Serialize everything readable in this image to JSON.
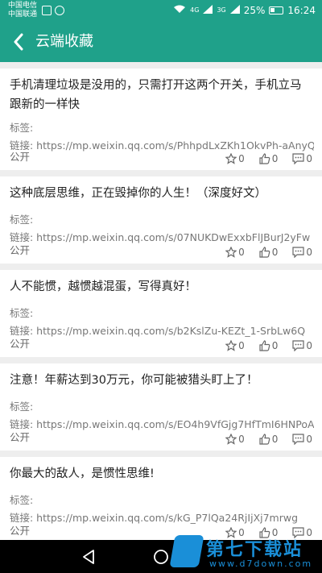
{
  "status_bar": {
    "carrier1": "中国电信",
    "carrier2": "中国联通",
    "network": "4G",
    "network_sub": "3G",
    "battery": "25%",
    "time": "16:24"
  },
  "app_bar": {
    "title": "云端收藏",
    "back_icon": "chevron-left-icon",
    "color": "#1fa18a"
  },
  "cards": [
    {
      "title": "手机清理垃圾是没用的，只需打开这两个开关，手机立马跟新的一样快",
      "tag": "标签:",
      "link": "链接: https://mp.weixin.qq.com/s/PhhpdLxZKh1OkvPh-aAnyQ",
      "public": "公开",
      "stars": "0",
      "likes": "0",
      "comments": "0"
    },
    {
      "title": "这种底层思维，正在毁掉你的人生！（深度好文）",
      "tag": "标签:",
      "link": "链接: https://mp.weixin.qq.com/s/07NUKDwExxbFlJBurJ2yFw",
      "public": "公开",
      "stars": "0",
      "likes": "0",
      "comments": "0"
    },
    {
      "title": "人不能惯，越惯越混蛋，写得真好！",
      "tag": "标签:",
      "link": "链接: https://mp.weixin.qq.com/s/b2KslZu-KEZt_1-SrbLw6Q",
      "public": "公开",
      "stars": "0",
      "likes": "0",
      "comments": "0"
    },
    {
      "title": "注意！年薪达到30万元，你可能被猎头盯上了！",
      "tag": "标签:",
      "link": "链接: https://mp.weixin.qq.com/s/EO4h9VfGjg7HfTmI6HNPoA",
      "public": "公开",
      "stars": "0",
      "likes": "0",
      "comments": "0"
    },
    {
      "title": "你最大的敌人，是惯性思维!",
      "tag": "标签:",
      "link": "链接: https://mp.weixin.qq.com/s/kG_P7lQa24RjIjXj7mrwg",
      "public": "公开",
      "stars": "0",
      "likes": "0",
      "comments": "0"
    }
  ],
  "watermark": {
    "text": "第七下载站",
    "url": "www.d7down.com"
  }
}
